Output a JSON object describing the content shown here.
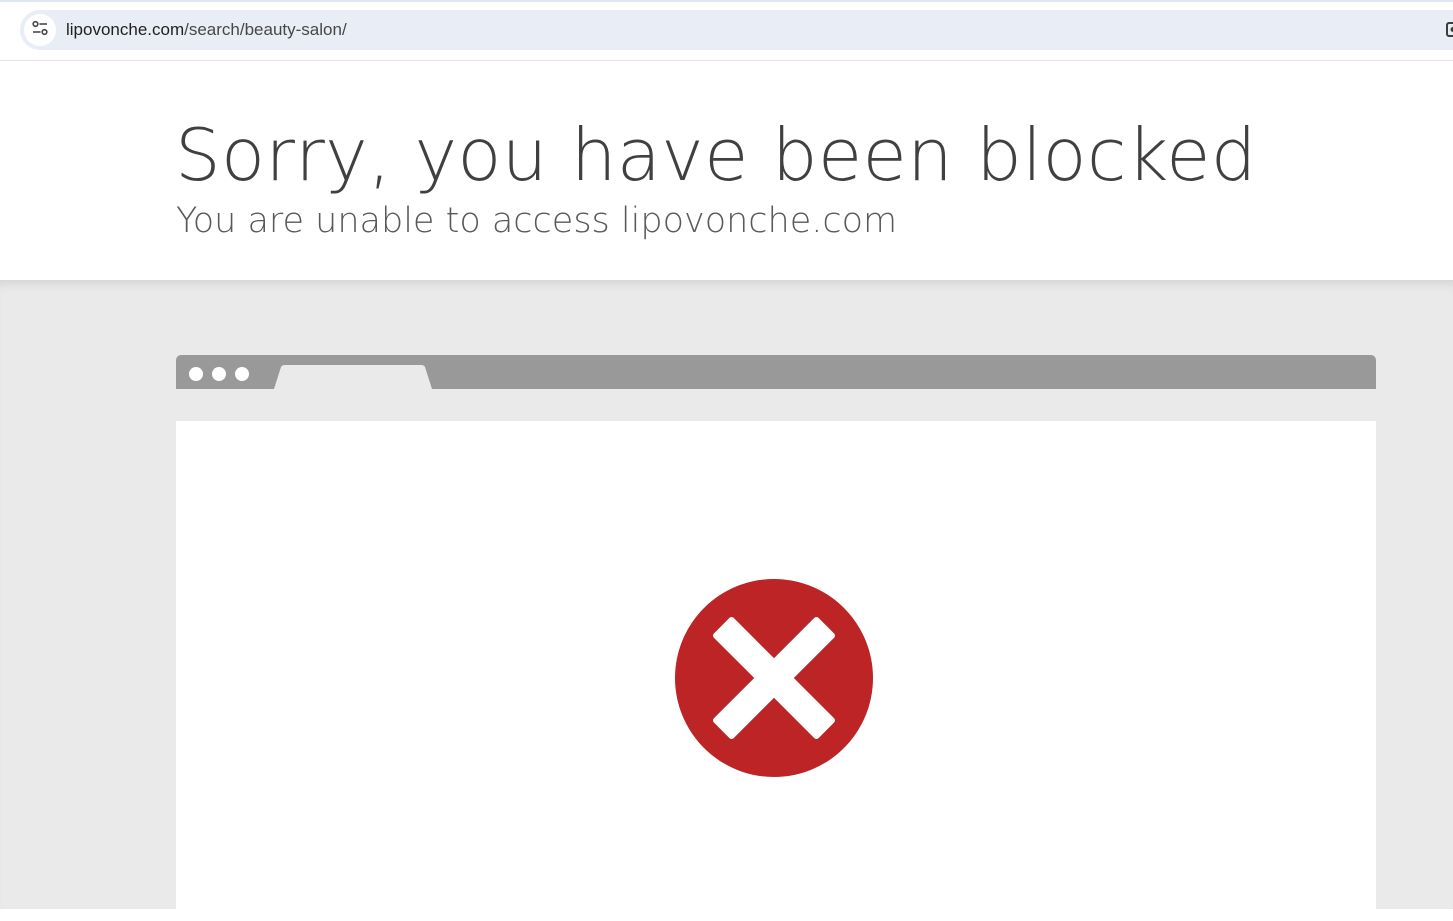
{
  "browser": {
    "url_domain": "lipovonche.com",
    "url_path": "/search/beauty-salon/",
    "site_info_icon": "tune-icon",
    "extension_icon": "extension-icon"
  },
  "page": {
    "headline": "Sorry, you have been blocked",
    "subheadline": "You are unable to access lipovonche.com"
  },
  "illustration": {
    "window_dots": 3,
    "status_icon": "error-x-icon",
    "colors": {
      "error_red": "#bd2426",
      "bar_grey": "#999999",
      "section_grey": "#eaeaea"
    }
  }
}
